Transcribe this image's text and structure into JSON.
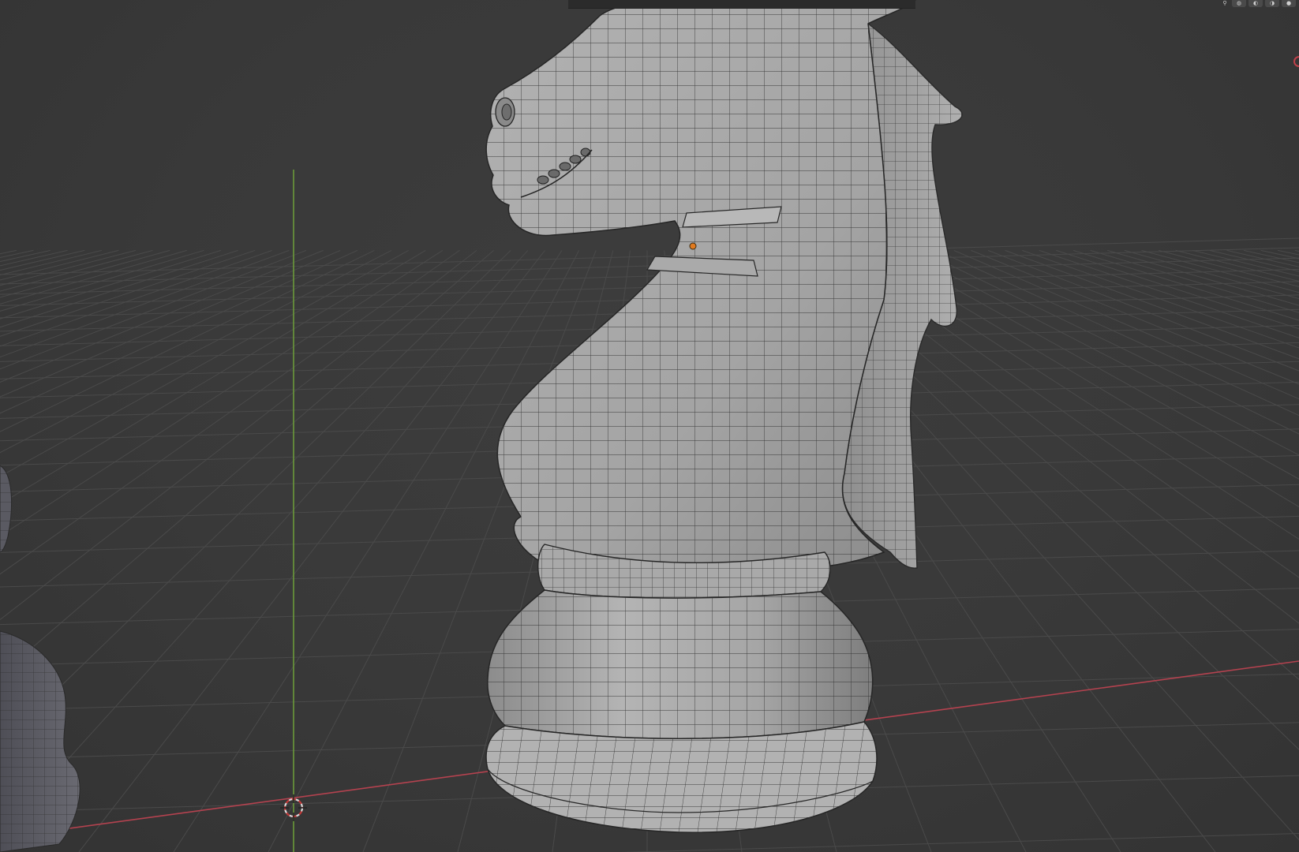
{
  "viewport": {
    "background": "#393939",
    "grid_color": "#4b4b4b",
    "x_axis_color": "#b4424f",
    "y_axis_color": "#6b9a3a",
    "mesh_fill": "#a3a3a3",
    "wire_color": "#2c2c2c",
    "origin_color": "#e07a1f"
  },
  "header": {
    "buttons": [
      {
        "icon": "overlay-icon"
      },
      {
        "icon": "wireframe-shading-icon"
      },
      {
        "icon": "solid-shading-icon"
      },
      {
        "icon": "material-shading-icon"
      },
      {
        "icon": "rendered-shading-icon"
      }
    ]
  },
  "objects": [
    {
      "name": "knight",
      "selected": true
    },
    {
      "name": "pawn-left",
      "selected": false
    }
  ],
  "cursor_3d": {
    "icon": "3d-cursor-icon"
  }
}
